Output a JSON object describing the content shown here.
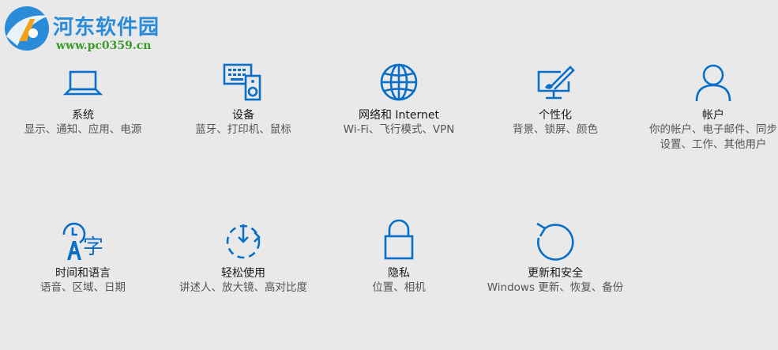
{
  "watermark": {
    "title": "河东软件园",
    "url": "www.pc0359.cn"
  },
  "colors": {
    "accent": "#0a6fc6",
    "background": "#e9e9e9"
  },
  "tiles": [
    {
      "icon": "laptop-icon",
      "title": "系统",
      "desc": "显示、通知、应用、电源"
    },
    {
      "icon": "devices-icon",
      "title": "设备",
      "desc": "蓝牙、打印机、鼠标"
    },
    {
      "icon": "globe-icon",
      "title": "网络和 Internet",
      "desc": "Wi-Fi、飞行模式、VPN"
    },
    {
      "icon": "personalize-icon",
      "title": "个性化",
      "desc": "背景、锁屏、颜色"
    },
    {
      "icon": "person-icon",
      "title": "帐户",
      "desc": "你的帐户、电子邮件、同步设置、工作、其他用户"
    },
    {
      "icon": "time-language-icon",
      "title": "时间和语言",
      "desc": "语音、区域、日期"
    },
    {
      "icon": "ease-of-access-icon",
      "title": "轻松使用",
      "desc": "讲述人、放大镜、高对比度"
    },
    {
      "icon": "lock-icon",
      "title": "隐私",
      "desc": "位置、相机"
    },
    {
      "icon": "refresh-icon",
      "title": "更新和安全",
      "desc": "Windows 更新、恢复、备份"
    }
  ]
}
